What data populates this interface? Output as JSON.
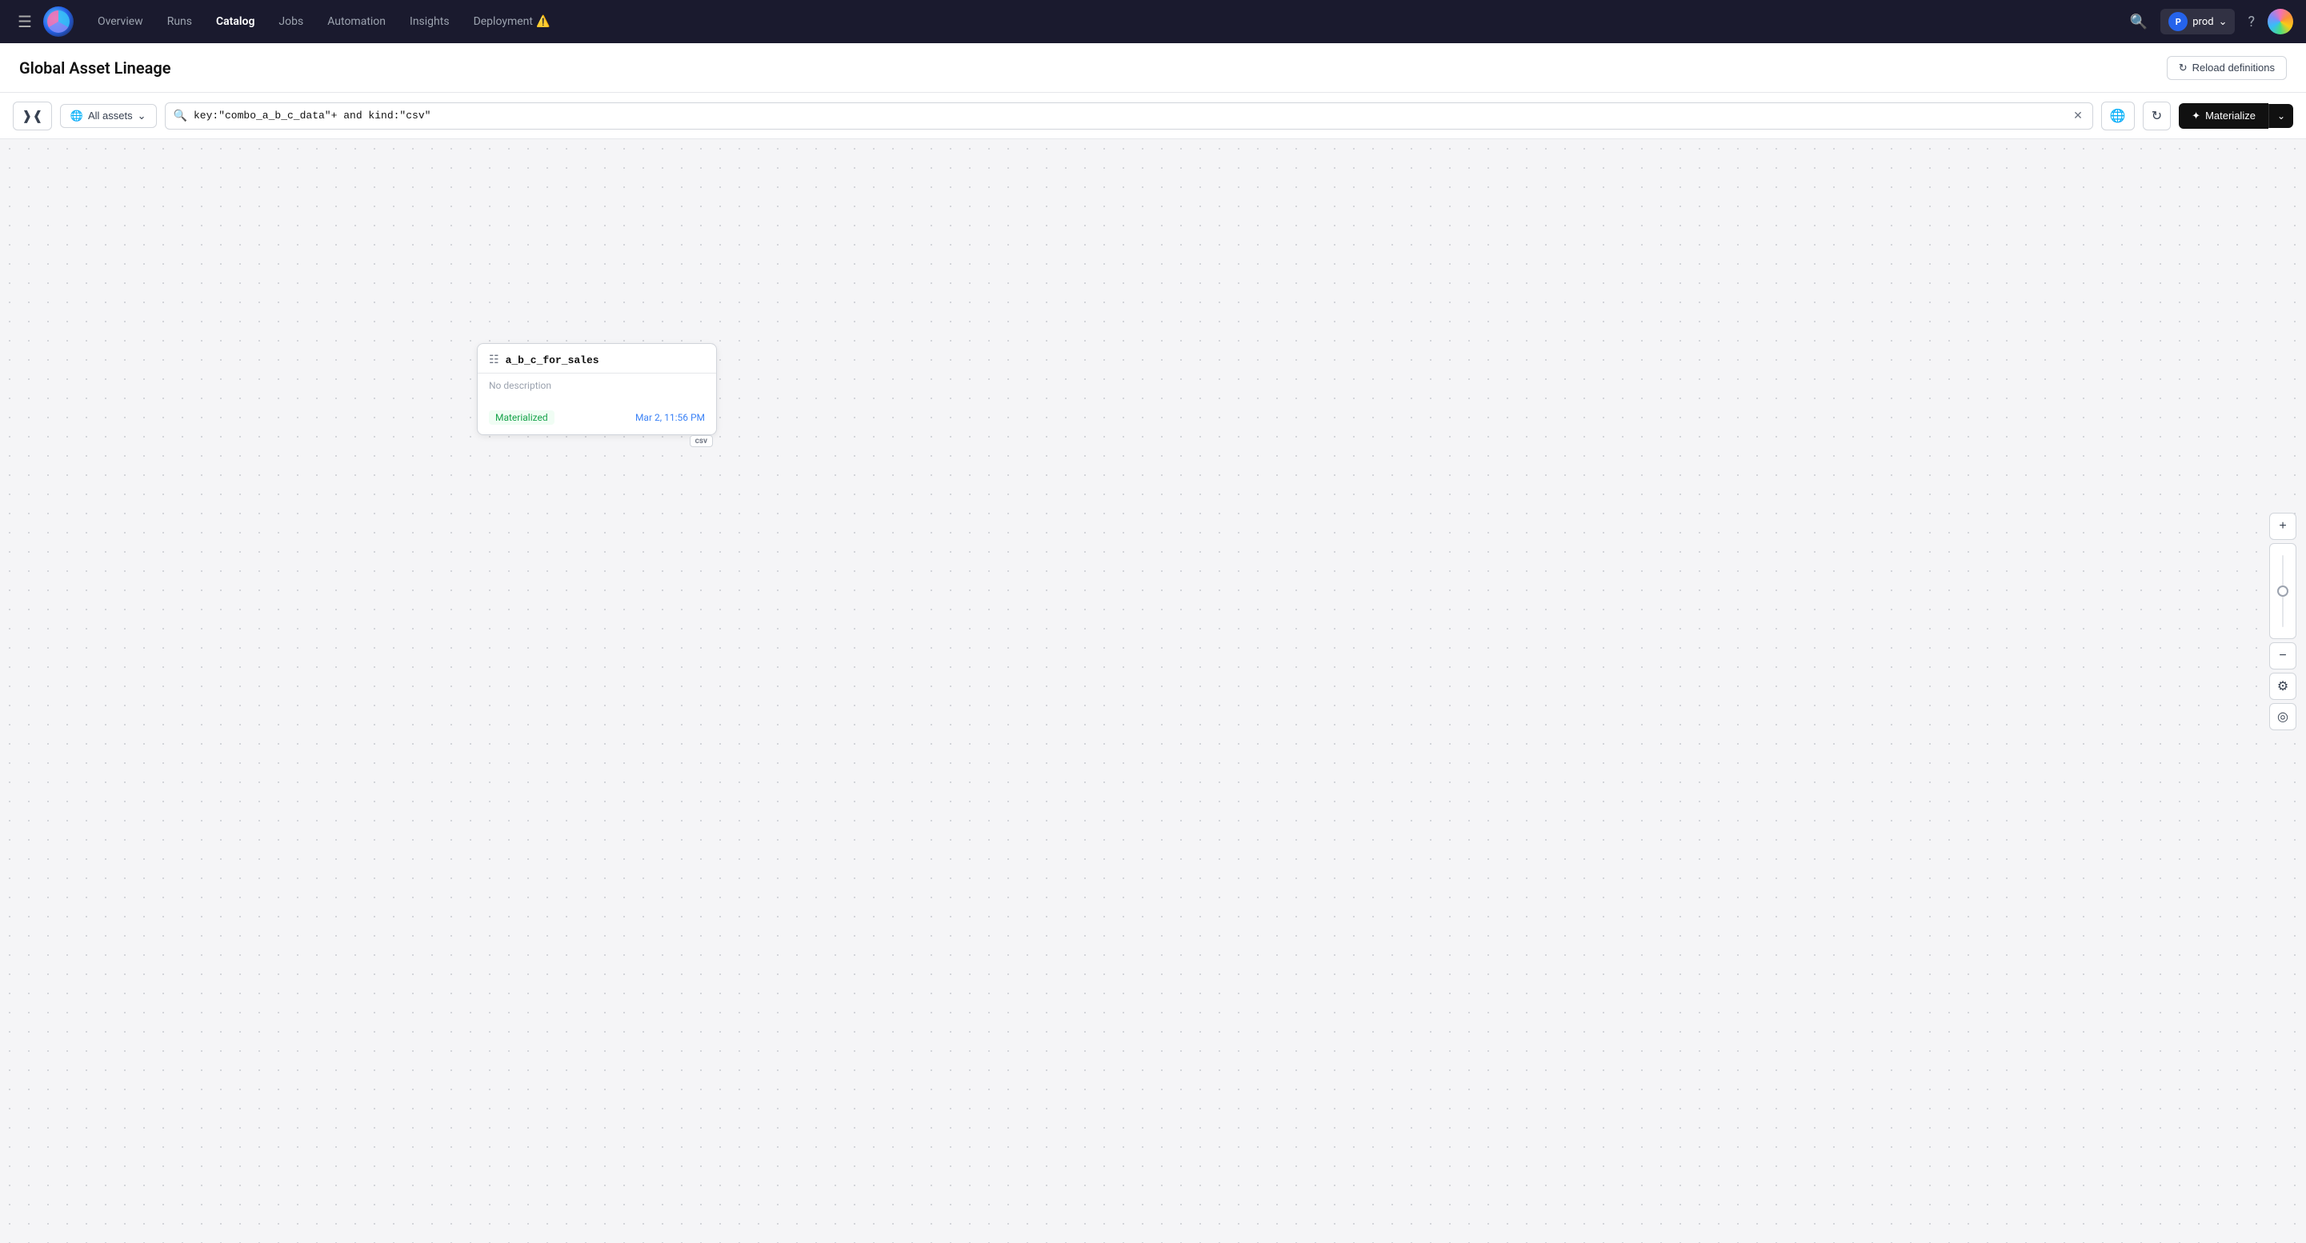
{
  "nav": {
    "links": [
      {
        "id": "overview",
        "label": "Overview",
        "active": false
      },
      {
        "id": "runs",
        "label": "Runs",
        "active": false
      },
      {
        "id": "catalog",
        "label": "Catalog",
        "active": true
      },
      {
        "id": "jobs",
        "label": "Jobs",
        "active": false
      },
      {
        "id": "automation",
        "label": "Automation",
        "active": false
      },
      {
        "id": "insights",
        "label": "Insights",
        "active": false
      },
      {
        "id": "deployment",
        "label": "Deployment",
        "active": false,
        "warning": true
      }
    ],
    "prod_label": "prod",
    "prod_avatar_letter": "P"
  },
  "page": {
    "title": "Global Asset Lineage",
    "reload_btn": "Reload definitions"
  },
  "toolbar": {
    "all_assets_label": "All assets",
    "search_value": "key:\"combo_a_b_c_data\"+ and kind:\"csv\"",
    "materialize_label": "Materialize"
  },
  "asset_node": {
    "title": "a_b_c_for_sales",
    "description": "No description",
    "status": "Materialized",
    "timestamp": "Mar 2, 11:56 PM",
    "badge": "csv"
  }
}
